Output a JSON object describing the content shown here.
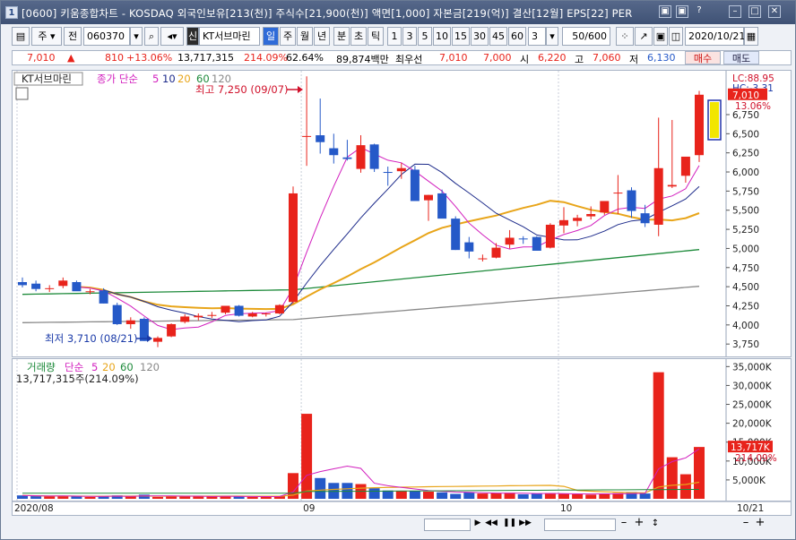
{
  "window": {
    "number": "1",
    "title": "[0600] 키움종합차트 - KOSDAQ 외국인보유[213(천)] 주식수[21,900(천)] 액면[1,000] 자본금[219(억)] 결산[12월] EPS[22] PER",
    "controls": [
      "▣",
      "▣",
      "?",
      "–",
      "□",
      "✕"
    ]
  },
  "toolbar": {
    "type_label": "주",
    "market_label": "전",
    "stock_code": "060370",
    "badge": "신",
    "stock_name": "KT서브마린",
    "periods": [
      "일",
      "주",
      "월",
      "년",
      "분",
      "초",
      "틱"
    ],
    "selected_period": "일",
    "intervals": [
      "1",
      "3",
      "5",
      "10",
      "15",
      "30",
      "45",
      "60"
    ],
    "interval_value": "3",
    "count": "50/600",
    "date": "2020/10/21"
  },
  "quote": {
    "price": "7,010",
    "arrow": "▲",
    "change": "810",
    "change_pct": "+13.06%",
    "volume": "13,717,315",
    "volume_ratio": "214.09%",
    "turnover": "62.64%",
    "amount": "89,874백만",
    "best_ask_label": "최우선",
    "best_ask": "7,010",
    "best_bid": "7,000",
    "open_label": "시",
    "open": "6,220",
    "high_label": "고",
    "high": "7,060",
    "low_label": "저",
    "low": "6,130",
    "buy_label": "매수",
    "sell_label": "매도"
  },
  "price_panel": {
    "legend_name": "KT서브마린",
    "legend_ma_label": "종가 단순",
    "ma_periods": [
      "5",
      "10",
      "20",
      "60",
      "120"
    ],
    "lc": "LC:88.95",
    "hc": "HC:-3.31",
    "high_note": "최고 7,250 (09/07)",
    "low_note": "최저 3,710 (08/21)",
    "last_price": "7,010",
    "last_pct": "13.06%",
    "y_ticks": [
      "6,750",
      "6,500",
      "6,250",
      "6,000",
      "5,750",
      "5,500",
      "5,250",
      "5,000",
      "4,750",
      "4,500",
      "4,250",
      "4,000",
      "3,750"
    ]
  },
  "volume_panel": {
    "legend_name": "거래량",
    "legend_ma_label": "단순",
    "ma_periods": [
      "5",
      "20",
      "60",
      "120"
    ],
    "info": "13,717,315주(214.09%)",
    "last_volume": "13,717K",
    "last_pct": "214.09%",
    "y_ticks": [
      "35,000K",
      "30,000K",
      "25,000K",
      "20,000K",
      "15,000K",
      "10,000K",
      "5,000K"
    ]
  },
  "x_axis": {
    "labels": [
      "2020/08",
      "09",
      "10",
      "10/21"
    ]
  },
  "colors": {
    "up": "#e8231b",
    "down": "#2559c8",
    "ma5": "#d21fbe",
    "ma10": "#1c2a8a",
    "ma20": "#e8a51a",
    "ma60": "#1d8a3a",
    "ma120": "#888888"
  },
  "chart_data": {
    "type": "candlestick",
    "x_start": "2020-08-03",
    "x_end": "2020-10-21",
    "ylim": [
      3600,
      7300
    ],
    "candles": [
      [
        4560,
        4620,
        4490,
        4520
      ],
      [
        4540,
        4580,
        4440,
        4470
      ],
      [
        4470,
        4520,
        4430,
        4480
      ],
      [
        4510,
        4620,
        4480,
        4580
      ],
      [
        4560,
        4580,
        4450,
        4440
      ],
      [
        4430,
        4470,
        4400,
        4440
      ],
      [
        4450,
        4480,
        4280,
        4280
      ],
      [
        4260,
        4290,
        4000,
        4010
      ],
      [
        4010,
        4100,
        3950,
        4060
      ],
      [
        4080,
        4100,
        3790,
        3790
      ],
      [
        3780,
        3850,
        3710,
        3830
      ],
      [
        3850,
        4020,
        3840,
        4010
      ],
      [
        4040,
        4140,
        4020,
        4110
      ],
      [
        4100,
        4150,
        4060,
        4120
      ],
      [
        4120,
        4170,
        4090,
        4130
      ],
      [
        4160,
        4250,
        4140,
        4250
      ],
      [
        4250,
        4260,
        4110,
        4120
      ],
      [
        4110,
        4170,
        4100,
        4150
      ],
      [
        4140,
        4160,
        4110,
        4150
      ],
      [
        4150,
        4270,
        4140,
        4260
      ],
      [
        4300,
        5810,
        4280,
        5720
      ],
      [
        6470,
        7250,
        6080,
        6470
      ],
      [
        6480,
        6960,
        6240,
        6390
      ],
      [
        6310,
        6500,
        6110,
        6220
      ],
      [
        6190,
        6420,
        6150,
        6170
      ],
      [
        6040,
        6480,
        5990,
        6350
      ],
      [
        6360,
        6370,
        6000,
        6040
      ],
      [
        6000,
        6070,
        5820,
        5990
      ],
      [
        6010,
        6120,
        5910,
        6050
      ],
      [
        6030,
        6080,
        5680,
        5620
      ],
      [
        5630,
        5700,
        5360,
        5700
      ],
      [
        5720,
        5770,
        5400,
        5390
      ],
      [
        5390,
        5420,
        4980,
        4980
      ],
      [
        5080,
        5150,
        4870,
        4960
      ],
      [
        4860,
        4920,
        4830,
        4870
      ],
      [
        4880,
        5070,
        4870,
        5010
      ],
      [
        5050,
        5240,
        5000,
        5140
      ],
      [
        5130,
        5160,
        5060,
        5120
      ],
      [
        5150,
        5160,
        4970,
        4970
      ],
      [
        5010,
        5330,
        5000,
        5310
      ],
      [
        5300,
        5540,
        5200,
        5370
      ],
      [
        5360,
        5440,
        5290,
        5400
      ],
      [
        5420,
        5550,
        5380,
        5450
      ],
      [
        5470,
        5610,
        5440,
        5620
      ],
      [
        5730,
        5960,
        5450,
        5730
      ],
      [
        5760,
        5800,
        5400,
        5490
      ],
      [
        5460,
        5570,
        5280,
        5330
      ],
      [
        5310,
        6710,
        5160,
        6050
      ],
      [
        5810,
        6680,
        5790,
        5830
      ],
      [
        5950,
        6100,
        5860,
        6200
      ],
      [
        6220,
        7060,
        6130,
        7010
      ]
    ],
    "volume_k": [
      900,
      700,
      600,
      800,
      600,
      500,
      700,
      900,
      600,
      1100,
      500,
      700,
      700,
      600,
      600,
      800,
      600,
      500,
      500,
      700,
      6800,
      22500,
      5500,
      4200,
      4200,
      3900,
      2800,
      2200,
      2000,
      2100,
      1900,
      1700,
      1300,
      1700,
      1400,
      1500,
      1600,
      1200,
      1300,
      1500,
      1300,
      1200,
      1100,
      1400,
      1500,
      1800,
      1400,
      33500,
      11000,
      6500,
      13717
    ],
    "moving_averages": [
      "5",
      "10",
      "20",
      "60",
      "120"
    ],
    "last_close": 7010
  }
}
